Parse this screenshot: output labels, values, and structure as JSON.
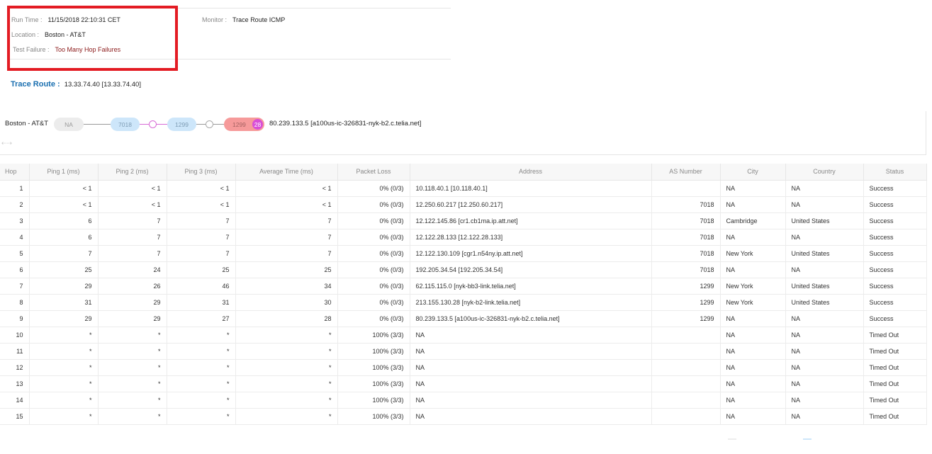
{
  "info": {
    "run_time_label": "Run Time :",
    "run_time": "11/15/2018 22:10:31 CET",
    "location_label": "Location :",
    "location": "Boston - AT&T",
    "test_failure_label": "Test Failure :",
    "test_failure": "Too Many Hop Failures",
    "monitor_label": "Monitor :",
    "monitor": "Trace Route ICMP"
  },
  "trace_route": {
    "label": "Trace Route :",
    "target": "13.33.74.40 [13.33.74.40]"
  },
  "path_diagram": {
    "source": "Boston - AT&T",
    "nodes": [
      {
        "label": "NA"
      },
      {
        "label": "7018"
      },
      {
        "label": "1299"
      },
      {
        "label": "1299",
        "badge": "28"
      }
    ],
    "destination": "80.239.133.5 [a100us-ic-326831-nyk-b2.c.telia.net]",
    "colors": {
      "na": "#ececec",
      "as": "#cde6fa",
      "failed": "#f69a9a",
      "badge": "#d94fd6"
    }
  },
  "table": {
    "columns": [
      "Hop",
      "Ping 1 (ms)",
      "Ping 2 (ms)",
      "Ping 3 (ms)",
      "Average Time (ms)",
      "Packet Loss",
      "Address",
      "AS Number",
      "City",
      "Country",
      "Status"
    ],
    "rows": [
      [
        "1",
        "< 1",
        "< 1",
        "< 1",
        "< 1",
        "0% (0/3)",
        "10.118.40.1 [10.118.40.1]",
        "",
        "NA",
        "NA",
        "Success"
      ],
      [
        "2",
        "< 1",
        "< 1",
        "< 1",
        "< 1",
        "0% (0/3)",
        "12.250.60.217 [12.250.60.217]",
        "7018",
        "NA",
        "NA",
        "Success"
      ],
      [
        "3",
        "6",
        "7",
        "7",
        "7",
        "0% (0/3)",
        "12.122.145.86 [cr1.cb1ma.ip.att.net]",
        "7018",
        "Cambridge",
        "United States",
        "Success"
      ],
      [
        "4",
        "6",
        "7",
        "7",
        "7",
        "0% (0/3)",
        "12.122.28.133 [12.122.28.133]",
        "7018",
        "NA",
        "NA",
        "Success"
      ],
      [
        "5",
        "7",
        "7",
        "7",
        "7",
        "0% (0/3)",
        "12.122.130.109 [cgr1.n54ny.ip.att.net]",
        "7018",
        "New York",
        "United States",
        "Success"
      ],
      [
        "6",
        "25",
        "24",
        "25",
        "25",
        "0% (0/3)",
        "192.205.34.54 [192.205.34.54]",
        "7018",
        "NA",
        "NA",
        "Success"
      ],
      [
        "7",
        "29",
        "26",
        "46",
        "34",
        "0% (0/3)",
        "62.115.115.0 [nyk-bb3-link.telia.net]",
        "1299",
        "New York",
        "United States",
        "Success"
      ],
      [
        "8",
        "31",
        "29",
        "31",
        "30",
        "0% (0/3)",
        "213.155.130.28 [nyk-b2-link.telia.net]",
        "1299",
        "New York",
        "United States",
        "Success"
      ],
      [
        "9",
        "29",
        "29",
        "27",
        "28",
        "0% (0/3)",
        "80.239.133.5 [a100us-ic-326831-nyk-b2.c.telia.net]",
        "1299",
        "NA",
        "NA",
        "Success"
      ],
      [
        "10",
        "*",
        "*",
        "*",
        "*",
        "100% (3/3)",
        "NA",
        "",
        "NA",
        "NA",
        "Timed Out"
      ],
      [
        "11",
        "*",
        "*",
        "*",
        "*",
        "100% (3/3)",
        "NA",
        "",
        "NA",
        "NA",
        "Timed Out"
      ],
      [
        "12",
        "*",
        "*",
        "*",
        "*",
        "100% (3/3)",
        "NA",
        "",
        "NA",
        "NA",
        "Timed Out"
      ],
      [
        "13",
        "*",
        "*",
        "*",
        "*",
        "100% (3/3)",
        "NA",
        "",
        "NA",
        "NA",
        "Timed Out"
      ],
      [
        "14",
        "*",
        "*",
        "*",
        "*",
        "100% (3/3)",
        "NA",
        "",
        "NA",
        "NA",
        "Timed Out"
      ],
      [
        "15",
        "*",
        "*",
        "*",
        "*",
        "100% (3/3)",
        "NA",
        "",
        "NA",
        "NA",
        "Timed Out"
      ]
    ]
  }
}
